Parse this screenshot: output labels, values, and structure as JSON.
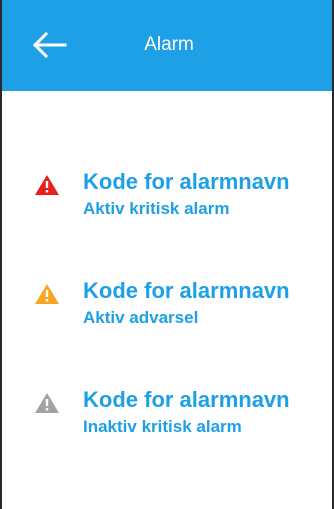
{
  "header": {
    "back_icon": "arrow-left-icon",
    "title": "Alarm",
    "color": "#1ea0e6"
  },
  "alarms": [
    {
      "name": "Kode for alarmnavn",
      "status": "Aktiv kritisk alarm",
      "icon": "warning-triangle-icon",
      "icon_color": "#e8201c"
    },
    {
      "name": "Kode for alarmnavn",
      "status": "Aktiv advarsel",
      "icon": "warning-triangle-icon",
      "icon_color": "#f6a623"
    },
    {
      "name": "Kode for alarmnavn",
      "status": "Inaktiv kritisk alarm",
      "icon": "warning-triangle-icon",
      "icon_color": "#a3a3a3"
    }
  ],
  "colors": {
    "accent": "#1ea0e6",
    "background": "#ffffff"
  }
}
